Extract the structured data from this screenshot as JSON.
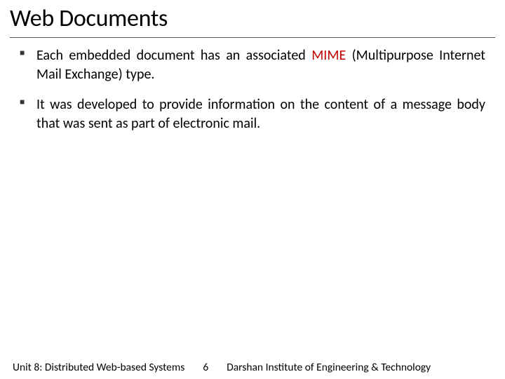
{
  "title": "Web Documents",
  "bullets": [
    {
      "parts": [
        {
          "text": "Each embedded document has an associated "
        },
        {
          "text": "MIME",
          "highlight": true
        },
        {
          "text": " (Multipurpose Internet Mail Exchange) type."
        }
      ]
    },
    {
      "parts": [
        {
          "text": "It was developed to provide information on the content of a message body that was sent as part of electronic mail."
        }
      ]
    }
  ],
  "footer": {
    "unit": "Unit 8: Distributed Web-based Systems",
    "page": "6",
    "org": "Darshan Institute of Engineering & Technology"
  }
}
